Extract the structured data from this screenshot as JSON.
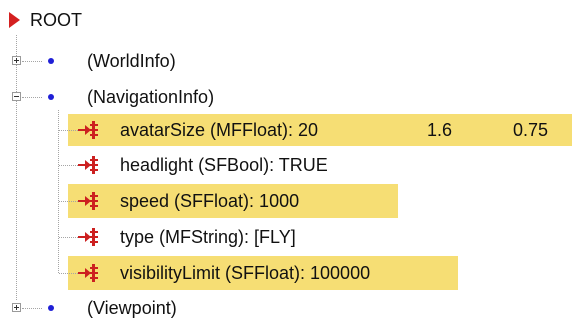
{
  "tree": {
    "root_label": "ROOT",
    "nodes": [
      {
        "label": "(WorldInfo)",
        "expanded": false
      },
      {
        "label": "(NavigationInfo)",
        "expanded": true,
        "fields": [
          {
            "label": "avatarSize (MFFloat): 20",
            "values": [
              "1.6",
              "0.75"
            ],
            "highlighted": true
          },
          {
            "label": "headlight (SFBool): TRUE",
            "highlighted": false
          },
          {
            "label": "speed (SFFloat): 1000",
            "highlighted": true
          },
          {
            "label": "type (MFString): [FLY]",
            "highlighted": false
          },
          {
            "label": "visibilityLimit (SFFloat): 100000",
            "highlighted": true
          }
        ]
      },
      {
        "label": "(Viewpoint)",
        "expanded": false
      }
    ]
  },
  "colors": {
    "root_arrow": "#d42020",
    "node_dot": "#1f1fd6",
    "highlight": "#f6de74",
    "field_icon": "#cc2020"
  },
  "icons": {
    "root": "red-triangle-icon",
    "node": "blue-dot-icon",
    "field": "field-arrow-icon"
  }
}
